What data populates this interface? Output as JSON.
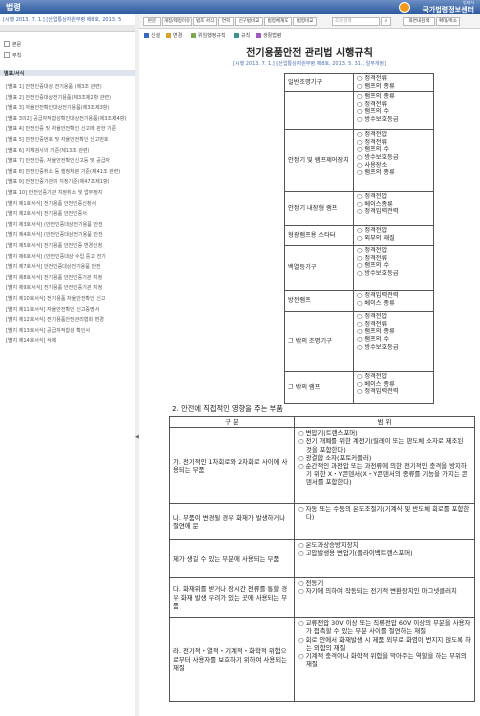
{
  "window": {
    "title": "법령"
  },
  "logo": {
    "sub": "법제처",
    "main": "국가법령정보센터"
  },
  "left": {
    "law_line": "[시행 2013. 7. 1.] [산업통상자원부령 제8호, 2013. 5",
    "tree": [
      {
        "label": "본문"
      },
      {
        "label": "부칙"
      }
    ],
    "group_label": "별표/서식",
    "items": [
      "[별표 1] 안전인증대상 전기용품 (제3조 관련)",
      "[별표 2] 안전인증대상전기용품(제3조제2항 관련)",
      "[별표 3] 자율안전확인대상전기용품(제3조제3항)",
      "[별표 3의2] 공급자적합성확인대상전기용품(제3조제4항)",
      "[별표 4] 안전인증 및 자율안전확인 신고에 관한 기준",
      "[별표 5] 안전인증번호 및 자율안전확인 신고번호",
      "[별표 6] 지체검사의 기준(제13조 관련)",
      "[별표 7] 안전인증, 자율안전확인신고등 및 공급자",
      "[별표 8] 안전인증취소 등 행정처분 기준(제41조 관련)",
      "[별표 9] 안전인증기관의 지정기준(제47조제1항)",
      "[별표 10] 안전인증기관 지정취소 및 업무정지",
      "[별지 제1호서식] 전기용품 안전인증신청서",
      "[별지 제2호서식] 전기용품 안전인증서",
      "[별지 제3호서식] (안전인증대상전기용품 안전",
      "[별지 제4호서식] (안전인증대상전기용품 안전",
      "[별지 제5호서식] 전기용품 안전인증 변경신청",
      "[별지 제6호서식] (안전인증대상 수입 중고 전기",
      "[별지 제7호서식] 안전인증대상전기용품 안전",
      "[별지 제8호서식] 전기용품 안전인증기관 지정",
      "[별지 제9호서식] 전기용품 안전인증기관 지정",
      "[별지 제10호서식] 전기용품 자율안전확인 신고",
      "[별지 제11호서식] 자율안전확인 신고증명서",
      "[별지 제12호서식] 전기용품안전관리협회 변경",
      "[별지 제13호서식] 공급자적합성 확인서",
      "[별지 제14호서식] 삭제"
    ]
  },
  "toolbar": {
    "buttons": [
      "본문",
      "개정/제정이유",
      "법조 서식",
      "연혁",
      "신구법비교",
      "법령체계도",
      "법령비교"
    ],
    "search_placeholder": "조문검색",
    "right_buttons": [
      "화면내검색",
      "확대/축소"
    ]
  },
  "legend": [
    {
      "label": "신설",
      "color": "#3a66c4"
    },
    {
      "label": "변경",
      "color": "#d7a329"
    },
    {
      "label": "위임행정규칙",
      "color": "#7aa84a"
    },
    {
      "label": "규칙",
      "color": "#3f8f8a"
    },
    {
      "label": "생활법령",
      "color": "#a45ac0"
    }
  ],
  "document": {
    "title": "전기용품안전 관리법 시행규칙",
    "subtitle": "[시행 2013. 7. 1.] [산업통상자원부령 제8호, 2013. 5. 31., 일부개정]",
    "table1": [
      {
        "name": "일반조명기구",
        "opts": [
          "정격전류",
          "램프의 종류"
        ]
      },
      {
        "name": "",
        "opts": [
          "램프의 종류",
          "정격전류",
          "램프의 수",
          "방수보호등급"
        ]
      },
      {
        "name": "안정기 및 램프제어장치",
        "opts": [
          "정격전압",
          "정격전류",
          "램프의 수",
          "방수보호등급",
          "사용장소",
          "램프의 종류"
        ]
      },
      {
        "name": "안정기 내장형 램프",
        "opts": [
          "정격전압",
          "베이스종류",
          "정격입력전력"
        ]
      },
      {
        "name": "형광램프용 스타터",
        "opts": [
          "정격전압",
          "외부의 재질"
        ]
      },
      {
        "name": "백열등기구",
        "opts": [
          "정격전압",
          "정격전류",
          "램프의 수",
          "방수보호등급"
        ]
      },
      {
        "name": "방전램프",
        "opts": [
          "정격입력전력",
          "베이스 종류"
        ]
      },
      {
        "name": "그 밖의 조명기구",
        "opts": [
          "정격전압",
          "정격전류",
          "램프의 종류",
          "램프의 수",
          "방수보호등급"
        ]
      },
      {
        "name": "그 밖의 램프",
        "opts": [
          "정격전압",
          "베이스 종류",
          "정격입력전력"
        ]
      }
    ],
    "section2_title": "2. 안전에 직접적인 영향을 주는 부품",
    "table2_headers": [
      "구 분",
      "범 위"
    ],
    "table2": [
      {
        "cat": "가. 전기적인 1차회로와 2차회로 사이에 사용되는 부품",
        "items": [
          "변압기(트랜스포머)",
          "전기 개폐를 위한 계전기(릴레이 또는 판도체 소자로 제조된 것을 포함한다)",
          "광결합 소자(포토커플러)",
          "순간적인 과전압 또는 과전류에 의한 전기적인 충격을 방지하기 위한 X・Y콘덴서(X・Y콘덴서의 종류를 기능을 가지는 콘덴서를 포함한다)"
        ]
      },
      {
        "cat": "나. 부품이 변경될 경우 화재가 발생하거나 절연에 문",
        "items": [
          "자동 또는 수동의 온도조절기(기계식 및 반도체 회로를 포함한다)"
        ]
      },
      {
        "cat": "제가 생길 수 있는 부분에 사용되는 부품",
        "items": [
          "온도과상승방지장치",
          "고압발생용 변압기(플라이백트랜스포머)"
        ]
      },
      {
        "cat": "다. 화재위를 받거나 장시간 전류를 통할 경우 화재 발생 우려가 있는 곳에 사용되는 부품",
        "items": [
          "전동기",
          "자기에 의하여 작동되는 전기적 변환장치인 마그넷클러치"
        ]
      },
      {
        "cat": "라. 전기적・열적・기계적・화학적 위험으로부터 사용자를 보호하기 위하여 사용되는 재질",
        "items": [
          "교류전압 30V 이상 또는 직류전압 60V 이상의 부분을 사용자가 접촉할 수 있는 부분 사이를 절연하는 재질",
          "회로 안에서 화재발생 시 제품 외부로 화염이 번지지 않도록 하는 외함의 재질",
          "기계적 충격이나 화학적 위험을 막아주는 역할을 하는 부위의 재질"
        ]
      }
    ]
  }
}
